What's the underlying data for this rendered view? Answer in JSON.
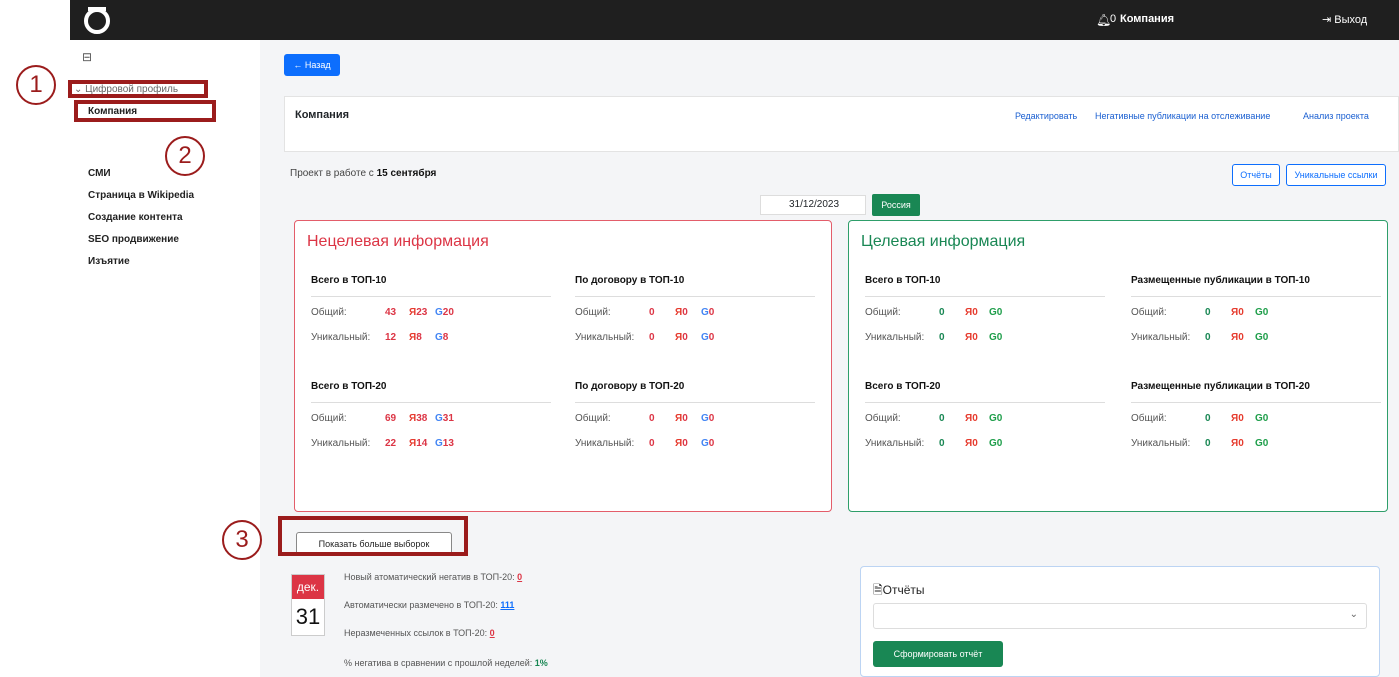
{
  "topbar": {
    "notifications_count": "0",
    "company": "Компания",
    "logout": "Выход",
    "bell_icon": "bell-icon",
    "logout_icon": "logout-icon"
  },
  "sidebar": {
    "section": "Цифровой профиль",
    "company": "Компания",
    "items": [
      "СМИ",
      "Страница в Wikipedia",
      "Создание контента",
      "SEO продвижение",
      "Изъятие"
    ]
  },
  "main": {
    "back": "← Назад",
    "header": {
      "title": "Компания",
      "links": [
        "Редактировать",
        "Негативные публикации на отслеживание",
        "Анализ проекта"
      ]
    },
    "project_since_prefix": "Проект в работе с ",
    "project_since_date": "15 сентября",
    "btn_reports": "Отчёты",
    "btn_unique": "Уникальные ссылки",
    "date_value": "31/12/2023",
    "region": "Россия"
  },
  "nontarget": {
    "title": "Нецелевая информация",
    "blocks": [
      {
        "head": "Всего в ТОП-10",
        "general": {
          "total": "43",
          "ya": "23",
          "g": "20"
        },
        "unique": {
          "total": "12",
          "ya": "8",
          "g": "8"
        }
      },
      {
        "head": "По договору в ТОП-10",
        "general": {
          "total": "0",
          "ya": "0",
          "g": "0"
        },
        "unique": {
          "total": "0",
          "ya": "0",
          "g": "0"
        }
      },
      {
        "head": "Всего в ТОП-20",
        "general": {
          "total": "69",
          "ya": "38",
          "g": "31"
        },
        "unique": {
          "total": "22",
          "ya": "14",
          "g": "13"
        }
      },
      {
        "head": "По договору в ТОП-20",
        "general": {
          "total": "0",
          "ya": "0",
          "g": "0"
        },
        "unique": {
          "total": "0",
          "ya": "0",
          "g": "0"
        }
      }
    ]
  },
  "target": {
    "title": "Целевая информация",
    "blocks": [
      {
        "head": "Всего в ТОП-10",
        "general": {
          "total": "0",
          "ya": "0",
          "g": "0"
        },
        "unique": {
          "total": "0",
          "ya": "0",
          "g": "0"
        }
      },
      {
        "head": "Размещенные публикации в ТОП-10",
        "general": {
          "total": "0",
          "ya": "0",
          "g": "0"
        },
        "unique": {
          "total": "0",
          "ya": "0",
          "g": "0"
        }
      },
      {
        "head": "Всего в ТОП-20",
        "general": {
          "total": "0",
          "ya": "0",
          "g": "0"
        },
        "unique": {
          "total": "0",
          "ya": "0",
          "g": "0"
        }
      },
      {
        "head": "Размещенные публикации в ТОП-20",
        "general": {
          "total": "0",
          "ya": "0",
          "g": "0"
        },
        "unique": {
          "total": "0",
          "ya": "0",
          "g": "0"
        }
      }
    ]
  },
  "labels": {
    "general": "Общий:",
    "unique": "Уникальный:",
    "ya": "Я",
    "g": "G"
  },
  "show_more": "Показать больше выборок",
  "calendar": {
    "month": "дек.",
    "day": "31"
  },
  "notes": {
    "auto_negative_label": "Новый атоматический негатив в ТОП-20: ",
    "auto_negative_value": "0",
    "auto_marked_label": "Автоматически размечено в ТОП-20: ",
    "auto_marked_value": "111",
    "unmarked_label": "Неразмеченных ссылок в ТОП-20: ",
    "unmarked_value": "0",
    "negative_pct_label": "% негатива в сравнении с прошлой неделей: ",
    "negative_pct_value": "1%"
  },
  "reports": {
    "title": "Отчёты",
    "generate": "Сформировать отчёт"
  },
  "annotations": [
    "1",
    "2",
    "3"
  ]
}
